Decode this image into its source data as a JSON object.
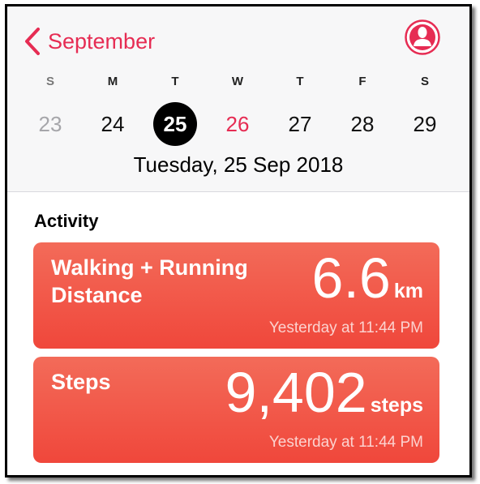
{
  "header": {
    "back_label": "September",
    "weekdays": [
      "S",
      "M",
      "T",
      "W",
      "T",
      "F",
      "S"
    ],
    "days": [
      "23",
      "24",
      "25",
      "26",
      "27",
      "28",
      "29"
    ],
    "selected_date_label": "Tuesday, 25 Sep 2018"
  },
  "activity": {
    "section_title": "Activity",
    "cards": [
      {
        "title_line1": "Walking + Running",
        "title_line2": "Distance",
        "value": "6.6",
        "unit": "km",
        "time": "Yesterday at 11:44 PM"
      },
      {
        "title_line1": "Steps",
        "title_line2": "",
        "value": "9,402",
        "unit": "steps",
        "time": "Yesterday at 11:44 PM"
      }
    ]
  },
  "colors": {
    "accent": "#e62c53",
    "card": "#f0473b",
    "selected": "#000000"
  },
  "icons": {
    "back": "chevron-left-icon",
    "profile": "profile-icon"
  }
}
